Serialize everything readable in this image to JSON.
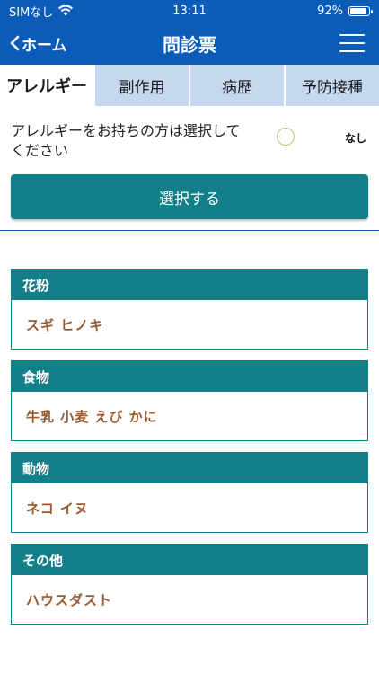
{
  "status": {
    "carrier": "SIMなし",
    "time": "13:11",
    "battery": "92%",
    "battery_level": 0.92
  },
  "nav": {
    "back_label": "ホーム",
    "title": "問診票"
  },
  "tabs": [
    {
      "label": "アレルギー",
      "active": true
    },
    {
      "label": "副作用"
    },
    {
      "label": "病歴"
    },
    {
      "label": "予防接種"
    }
  ],
  "question": {
    "text": "アレルギーをお持ちの方は選択してください",
    "none_label": "なし"
  },
  "select_button": "選択する",
  "categories": [
    {
      "title": "花粉",
      "items": "スギ ヒノキ"
    },
    {
      "title": "食物",
      "items": "牛乳 小麦 えび かに"
    },
    {
      "title": "動物",
      "items": "ネコ イヌ"
    },
    {
      "title": "その他",
      "items": "ハウスダスト"
    }
  ],
  "colors": {
    "header": "#0b5bb8",
    "teal": "#137f88",
    "tab_bg": "#c5d8ef",
    "item_text": "#9a5a2e",
    "radio": "#a6cf6a"
  }
}
